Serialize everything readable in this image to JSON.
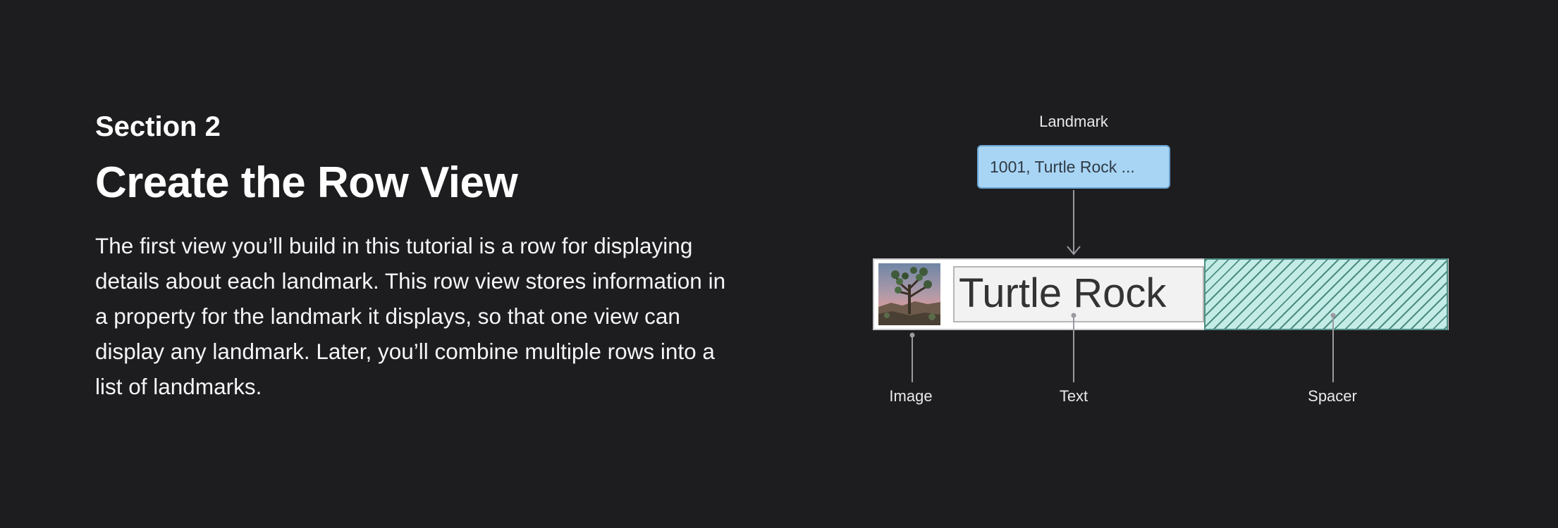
{
  "intro": {
    "section_label": "Section 2",
    "title": "Create the Row View",
    "body": "The first view you’ll build in this tutorial is a row for displaying details about each landmark. This row view stores information in a property for the landmark it displays, so that one view can display any landmark. Later, you’ll combine multiple rows into a list of landmarks."
  },
  "diagram": {
    "landmark_label": "Landmark",
    "landmark_value": "1001, Turtle Rock ...",
    "row_text": "Turtle Rock",
    "labels": {
      "image": "Image",
      "text": "Text",
      "spacer": "Spacer"
    },
    "colors": {
      "landmark_fill": "#a9d5f5",
      "spacer_fill": "#c4ece6",
      "spacer_stroke": "#4e8d84",
      "connector": "#9a9aa0"
    },
    "icons": {
      "thumbnail": "joshua-tree-photo"
    }
  }
}
